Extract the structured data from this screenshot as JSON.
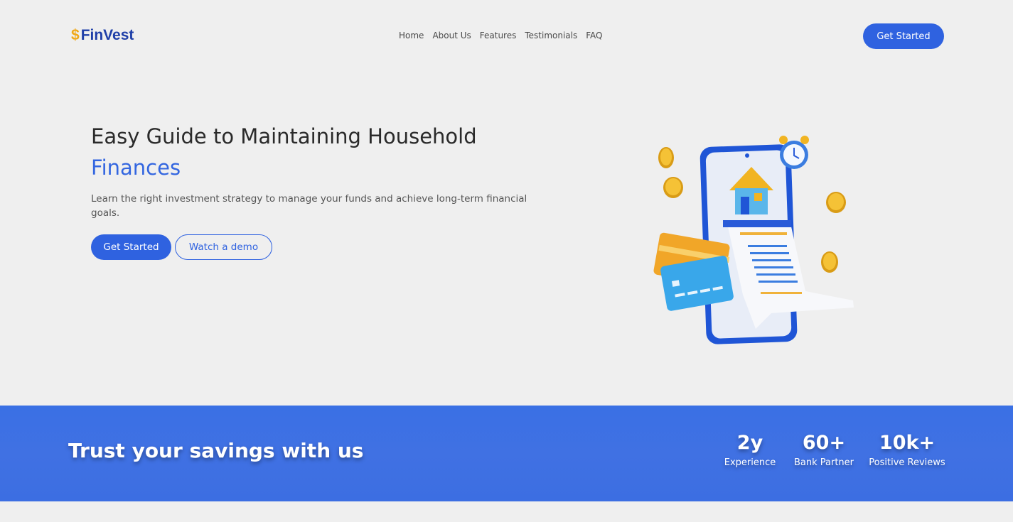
{
  "brand": {
    "symbol": "$",
    "name": "FinVest"
  },
  "nav": {
    "items": [
      {
        "label": "Home"
      },
      {
        "label": "About Us"
      },
      {
        "label": "Features"
      },
      {
        "label": "Testimonials"
      },
      {
        "label": "FAQ"
      }
    ],
    "cta_label": "Get Started"
  },
  "hero": {
    "title_line1": "Easy Guide to Maintaining Household",
    "title_accent": "Finances",
    "subtitle": "Learn the right investment strategy to manage your funds and achieve long-term financial goals.",
    "primary_label": "Get Started",
    "secondary_label": "Watch a demo",
    "illustration_icon": "phone-receipt-house-illustration"
  },
  "banner": {
    "title": "Trust your savings with us",
    "stats": [
      {
        "value": "2y",
        "label": "Experience"
      },
      {
        "value": "60+",
        "label": "Bank Partner"
      },
      {
        "value": "10k+",
        "label": "Positive Reviews"
      }
    ]
  },
  "colors": {
    "primary": "#2f62e0",
    "accent_text": "#3366e0",
    "banner": "#3d70e3",
    "logo": "#1f3fa8",
    "logo_symbol": "#f0a818",
    "background": "#efefef"
  }
}
